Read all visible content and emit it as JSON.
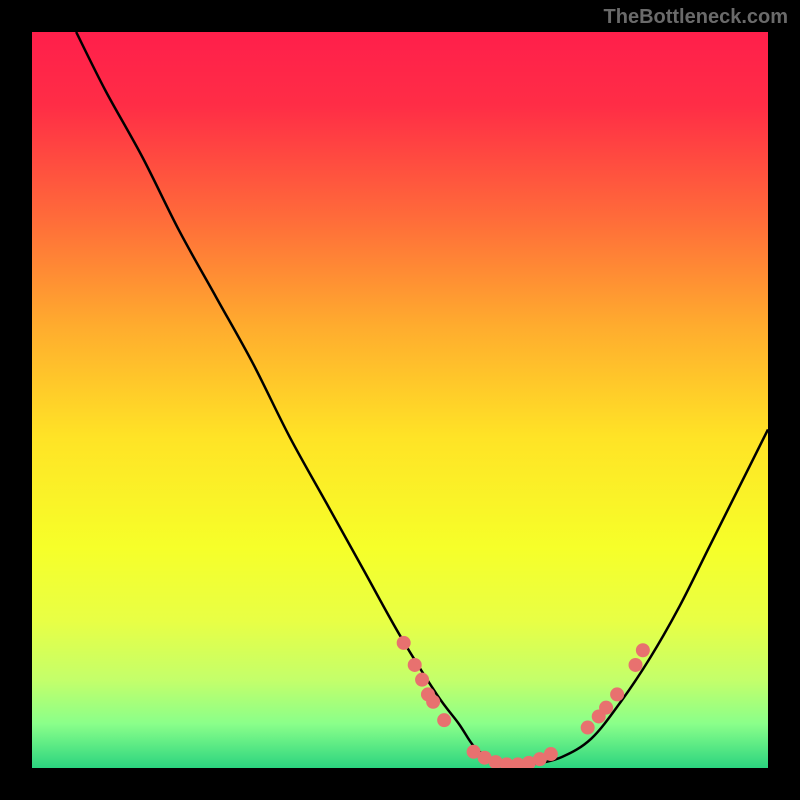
{
  "watermark": "TheBottleneck.com",
  "chart_data": {
    "type": "line",
    "title": "",
    "xlabel": "",
    "ylabel": "",
    "xlim": [
      0,
      100
    ],
    "ylim": [
      0,
      100
    ],
    "gradient_stops": [
      {
        "offset": 0.0,
        "color": "#ff1f4b"
      },
      {
        "offset": 0.1,
        "color": "#ff2d46"
      },
      {
        "offset": 0.25,
        "color": "#ff6a3a"
      },
      {
        "offset": 0.4,
        "color": "#ffac2e"
      },
      {
        "offset": 0.55,
        "color": "#ffe326"
      },
      {
        "offset": 0.7,
        "color": "#f6ff29"
      },
      {
        "offset": 0.8,
        "color": "#e8ff45"
      },
      {
        "offset": 0.88,
        "color": "#c4ff6a"
      },
      {
        "offset": 0.94,
        "color": "#8aff8a"
      },
      {
        "offset": 1.0,
        "color": "#2bd47f"
      }
    ],
    "series": [
      {
        "name": "bottleneck-curve",
        "stroke": "#000000",
        "x": [
          6,
          10,
          15,
          20,
          25,
          30,
          35,
          40,
          45,
          50,
          55,
          58,
          60,
          62,
          65,
          68,
          72,
          76,
          80,
          84,
          88,
          92,
          96,
          100
        ],
        "y": [
          100,
          92,
          83,
          73,
          64,
          55,
          45,
          36,
          27,
          18,
          10,
          6,
          3,
          1.5,
          0.5,
          0.5,
          1.5,
          4,
          9,
          15,
          22,
          30,
          38,
          46
        ]
      }
    ],
    "scatter": {
      "name": "highlight-dots",
      "fill": "#e8716f",
      "radius": 7,
      "points": [
        {
          "x": 50.5,
          "y": 17
        },
        {
          "x": 52.0,
          "y": 14
        },
        {
          "x": 53.0,
          "y": 12
        },
        {
          "x": 53.8,
          "y": 10
        },
        {
          "x": 54.5,
          "y": 9
        },
        {
          "x": 56.0,
          "y": 6.5
        },
        {
          "x": 60.0,
          "y": 2.2
        },
        {
          "x": 61.5,
          "y": 1.4
        },
        {
          "x": 63.0,
          "y": 0.8
        },
        {
          "x": 64.5,
          "y": 0.5
        },
        {
          "x": 66.0,
          "y": 0.5
        },
        {
          "x": 67.5,
          "y": 0.7
        },
        {
          "x": 69.0,
          "y": 1.2
        },
        {
          "x": 70.5,
          "y": 1.9
        },
        {
          "x": 75.5,
          "y": 5.5
        },
        {
          "x": 77.0,
          "y": 7.0
        },
        {
          "x": 78.0,
          "y": 8.2
        },
        {
          "x": 79.5,
          "y": 10.0
        },
        {
          "x": 82.0,
          "y": 14.0
        },
        {
          "x": 83.0,
          "y": 16.0
        }
      ]
    }
  }
}
